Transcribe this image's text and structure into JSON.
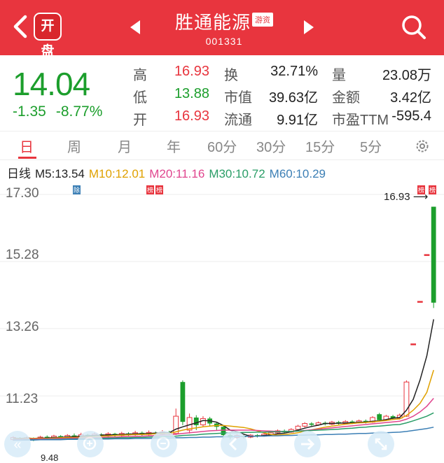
{
  "header": {
    "logo_text": "开盘",
    "stock_name": "胜通能源",
    "stock_tag": "游资",
    "stock_code": "001331",
    "icons": [
      "back-arrow-icon",
      "prev-arrow-icon",
      "next-arrow-icon",
      "search-icon"
    ]
  },
  "quote": {
    "price": "14.04",
    "change": "-1.35",
    "change_pct": "-8.77%",
    "rows": [
      [
        {
          "label": "高",
          "value": "16.93"
        },
        {
          "label": "换",
          "value": "32.71%"
        },
        {
          "label": "量",
          "value": "23.08万"
        }
      ],
      [
        {
          "label": "低",
          "value": "13.88"
        },
        {
          "label": "市值",
          "value": "39.63亿"
        },
        {
          "label": "金额",
          "value": "3.42亿"
        }
      ],
      [
        {
          "label": "开",
          "value": "16.93"
        },
        {
          "label": "流通",
          "value": "9.91亿"
        },
        {
          "label": "市盈TTM",
          "value": "-595.4"
        }
      ]
    ],
    "colors": {
      "up": "#e8353e",
      "down": "#1c9e2c"
    }
  },
  "tabs": [
    "日",
    "周",
    "月",
    "年",
    "60分",
    "30分",
    "15分",
    "5分"
  ],
  "active_tab": "日",
  "ma": {
    "label": "日线",
    "items": [
      {
        "text": "M5:13.54",
        "color": "#222222"
      },
      {
        "text": "M10:12.01",
        "color": "#e0a100"
      },
      {
        "text": "M20:11.16",
        "color": "#e0458e"
      },
      {
        "text": "M30:10.72",
        "color": "#2a9d67"
      },
      {
        "text": "M60:10.29",
        "color": "#3c7fb5"
      }
    ]
  },
  "chart_data": {
    "type": "candlestick",
    "y_ticks": [
      "17.30",
      "15.28",
      "13.26",
      "11.23"
    ],
    "last_high_label": "16.93",
    "low_label": "9.48",
    "markers": [
      {
        "text": "除",
        "color": "#3c7fb5"
      },
      {
        "text": "榜",
        "color": "#e8353e"
      },
      {
        "text": "榜",
        "color": "#e8353e"
      },
      {
        "text": "榜",
        "color": "#e8353e"
      },
      {
        "text": "榜",
        "color": "#e8353e"
      }
    ],
    "candles": [
      {
        "o": 9.92,
        "c": 9.98,
        "h": 10.02,
        "l": 9.88
      },
      {
        "o": 9.96,
        "c": 9.94,
        "h": 9.99,
        "l": 9.9
      },
      {
        "o": 9.93,
        "c": 9.97,
        "h": 10.01,
        "l": 9.89
      },
      {
        "o": 9.95,
        "c": 9.91,
        "h": 9.98,
        "l": 9.87
      },
      {
        "o": 9.92,
        "c": 9.99,
        "h": 10.03,
        "l": 9.9
      },
      {
        "o": 10.0,
        "c": 9.95,
        "h": 10.04,
        "l": 9.92
      },
      {
        "o": 9.96,
        "c": 10.02,
        "h": 10.06,
        "l": 9.94
      },
      {
        "o": 10.02,
        "c": 9.97,
        "h": 10.05,
        "l": 9.93
      },
      {
        "o": 9.98,
        "c": 10.04,
        "h": 10.08,
        "l": 9.95
      },
      {
        "o": 10.04,
        "c": 10.0,
        "h": 10.1,
        "l": 9.97
      },
      {
        "o": 10.01,
        "c": 10.06,
        "h": 10.12,
        "l": 9.98
      },
      {
        "o": 10.06,
        "c": 10.01,
        "h": 10.09,
        "l": 9.97
      },
      {
        "o": 10.02,
        "c": 10.08,
        "h": 10.13,
        "l": 10.0
      },
      {
        "o": 10.07,
        "c": 10.02,
        "h": 10.11,
        "l": 9.98
      },
      {
        "o": 10.03,
        "c": 10.09,
        "h": 10.14,
        "l": 10.0
      },
      {
        "o": 10.09,
        "c": 10.04,
        "h": 10.12,
        "l": 10.0
      },
      {
        "o": 10.04,
        "c": 10.1,
        "h": 10.15,
        "l": 10.01
      },
      {
        "o": 10.1,
        "c": 10.05,
        "h": 10.14,
        "l": 10.01
      },
      {
        "o": 10.06,
        "c": 10.12,
        "h": 10.18,
        "l": 10.03
      },
      {
        "o": 10.12,
        "c": 10.06,
        "h": 10.16,
        "l": 10.02
      },
      {
        "o": 10.07,
        "c": 10.13,
        "h": 10.19,
        "l": 10.04
      },
      {
        "o": 10.12,
        "c": 10.08,
        "h": 10.16,
        "l": 10.03
      },
      {
        "o": 10.08,
        "c": 10.14,
        "h": 10.2,
        "l": 10.05
      },
      {
        "o": 10.14,
        "c": 10.1,
        "h": 10.18,
        "l": 10.06
      },
      {
        "o": 10.1,
        "c": 10.62,
        "h": 10.85,
        "l": 10.05
      },
      {
        "o": 11.65,
        "c": 10.45,
        "h": 11.7,
        "l": 10.35
      },
      {
        "o": 10.2,
        "c": 10.58,
        "h": 10.7,
        "l": 10.1
      },
      {
        "o": 10.58,
        "c": 10.35,
        "h": 10.65,
        "l": 10.2
      },
      {
        "o": 10.36,
        "c": 10.55,
        "h": 10.62,
        "l": 10.3
      },
      {
        "o": 10.55,
        "c": 10.4,
        "h": 10.6,
        "l": 10.33
      },
      {
        "o": 10.4,
        "c": 10.3,
        "h": 10.45,
        "l": 10.2
      },
      {
        "o": 10.3,
        "c": 10.05,
        "h": 10.35,
        "l": 9.95
      },
      {
        "o": 10.05,
        "c": 9.98,
        "h": 10.1,
        "l": 9.92
      },
      {
        "o": 9.98,
        "c": 10.04,
        "h": 10.08,
        "l": 9.94
      },
      {
        "o": 10.02,
        "c": 9.99,
        "h": 10.06,
        "l": 9.95
      },
      {
        "o": 9.99,
        "c": 10.05,
        "h": 10.08,
        "l": 9.96
      },
      {
        "o": 10.05,
        "c": 10.02,
        "h": 10.08,
        "l": 9.98
      },
      {
        "o": 10.02,
        "c": 10.08,
        "h": 10.12,
        "l": 10.0
      },
      {
        "o": 10.07,
        "c": 10.12,
        "h": 10.16,
        "l": 10.04
      },
      {
        "o": 10.12,
        "c": 10.18,
        "h": 10.22,
        "l": 10.08
      },
      {
        "o": 10.18,
        "c": 10.14,
        "h": 10.22,
        "l": 10.1
      },
      {
        "o": 10.14,
        "c": 10.22,
        "h": 10.26,
        "l": 10.12
      },
      {
        "o": 10.22,
        "c": 10.32,
        "h": 10.36,
        "l": 10.18
      },
      {
        "o": 10.32,
        "c": 10.4,
        "h": 10.44,
        "l": 10.28
      },
      {
        "o": 10.4,
        "c": 10.36,
        "h": 10.44,
        "l": 10.32
      },
      {
        "o": 10.36,
        "c": 10.42,
        "h": 10.46,
        "l": 10.33
      },
      {
        "o": 10.42,
        "c": 10.38,
        "h": 10.46,
        "l": 10.34
      },
      {
        "o": 10.38,
        "c": 10.44,
        "h": 10.48,
        "l": 10.35
      },
      {
        "o": 10.44,
        "c": 10.4,
        "h": 10.48,
        "l": 10.36
      },
      {
        "o": 10.4,
        "c": 10.46,
        "h": 10.5,
        "l": 10.37
      },
      {
        "o": 10.46,
        "c": 10.42,
        "h": 10.5,
        "l": 10.38
      },
      {
        "o": 10.42,
        "c": 10.48,
        "h": 10.52,
        "l": 10.4
      },
      {
        "o": 10.48,
        "c": 10.44,
        "h": 10.52,
        "l": 10.4
      },
      {
        "o": 10.44,
        "c": 10.58,
        "h": 10.62,
        "l": 10.42
      },
      {
        "o": 10.68,
        "c": 10.5,
        "h": 10.72,
        "l": 10.46
      },
      {
        "o": 10.5,
        "c": 10.62,
        "h": 10.66,
        "l": 10.48
      },
      {
        "o": 10.62,
        "c": 10.56,
        "h": 10.66,
        "l": 10.52
      },
      {
        "o": 10.56,
        "c": 10.65,
        "h": 10.7,
        "l": 10.52
      },
      {
        "o": 10.62,
        "c": 11.65,
        "h": 11.7,
        "l": 10.6
      },
      {
        "o": 12.8,
        "c": 12.8,
        "h": 12.8,
        "l": 12.8
      },
      {
        "o": 14.08,
        "c": 14.08,
        "h": 14.08,
        "l": 14.08
      },
      {
        "o": 15.49,
        "c": 15.49,
        "h": 15.49,
        "l": 15.49
      },
      {
        "o": 16.93,
        "c": 14.04,
        "h": 16.93,
        "l": 13.88
      }
    ],
    "ma5": [
      9.95,
      9.95,
      9.96,
      9.95,
      9.96,
      9.96,
      9.98,
      9.98,
      10.0,
      10.0,
      10.02,
      10.03,
      10.04,
      10.05,
      10.06,
      10.06,
      10.07,
      10.08,
      10.09,
      10.09,
      10.1,
      10.11,
      10.12,
      10.12,
      10.23,
      10.3,
      10.36,
      10.42,
      10.49,
      10.48,
      10.44,
      10.34,
      10.2,
      10.15,
      10.08,
      10.01,
      10.02,
      10.04,
      10.06,
      10.09,
      10.11,
      10.15,
      10.2,
      10.26,
      10.31,
      10.35,
      10.4,
      10.4,
      10.41,
      10.42,
      10.42,
      10.44,
      10.44,
      10.47,
      10.48,
      10.52,
      10.56,
      10.58,
      10.8,
      11.13,
      11.71,
      12.44,
      13.54
    ],
    "ma10": [
      9.94,
      9.94,
      9.95,
      9.95,
      9.95,
      9.95,
      9.96,
      9.97,
      9.98,
      9.98,
      9.99,
      10.0,
      10.01,
      10.02,
      10.03,
      10.04,
      10.05,
      10.06,
      10.07,
      10.07,
      10.08,
      10.09,
      10.1,
      10.1,
      10.15,
      10.2,
      10.24,
      10.27,
      10.3,
      10.32,
      10.34,
      10.34,
      10.32,
      10.3,
      10.28,
      10.24,
      10.18,
      10.12,
      10.07,
      10.05,
      10.07,
      10.09,
      10.12,
      10.17,
      10.21,
      10.25,
      10.29,
      10.32,
      10.35,
      10.38,
      10.4,
      10.42,
      10.43,
      10.45,
      10.47,
      10.49,
      10.52,
      10.54,
      10.64,
      10.8,
      11.01,
      11.34,
      12.01
    ],
    "ma20": [
      9.92,
      9.92,
      9.93,
      9.93,
      9.93,
      9.94,
      9.94,
      9.95,
      9.95,
      9.96,
      9.96,
      9.97,
      9.97,
      9.98,
      9.99,
      9.99,
      10.0,
      10.01,
      10.01,
      10.02,
      10.03,
      10.04,
      10.05,
      10.06,
      10.08,
      10.1,
      10.12,
      10.14,
      10.16,
      10.18,
      10.19,
      10.2,
      10.2,
      10.2,
      10.2,
      10.2,
      10.19,
      10.18,
      10.17,
      10.16,
      10.16,
      10.16,
      10.17,
      10.19,
      10.21,
      10.23,
      10.25,
      10.27,
      10.29,
      10.31,
      10.33,
      10.35,
      10.37,
      10.39,
      10.41,
      10.43,
      10.45,
      10.47,
      10.53,
      10.62,
      10.75,
      10.92,
      11.16
    ],
    "ma30": [
      9.9,
      9.9,
      9.91,
      9.91,
      9.91,
      9.92,
      9.92,
      9.92,
      9.93,
      9.93,
      9.94,
      9.94,
      9.95,
      9.95,
      9.96,
      9.96,
      9.97,
      9.97,
      9.98,
      9.98,
      9.99,
      10.0,
      10.0,
      10.01,
      10.02,
      10.04,
      10.05,
      10.06,
      10.08,
      10.09,
      10.1,
      10.11,
      10.12,
      10.12,
      10.13,
      10.13,
      10.14,
      10.14,
      10.15,
      10.15,
      10.16,
      10.16,
      10.17,
      10.18,
      10.19,
      10.2,
      10.21,
      10.22,
      10.23,
      10.25,
      10.26,
      10.28,
      10.29,
      10.31,
      10.32,
      10.34,
      10.36,
      10.37,
      10.42,
      10.48,
      10.55,
      10.62,
      10.72
    ],
    "ma60": [
      9.9,
      9.9,
      9.9,
      9.9,
      9.91,
      9.91,
      9.91,
      9.91,
      9.92,
      9.92,
      9.92,
      9.92,
      9.93,
      9.93,
      9.93,
      9.94,
      9.94,
      9.94,
      9.95,
      9.95,
      9.95,
      9.96,
      9.96,
      9.96,
      9.97,
      9.97,
      9.98,
      9.98,
      9.99,
      9.99,
      10.0,
      10.0,
      10.0,
      10.01,
      10.01,
      10.02,
      10.02,
      10.02,
      10.03,
      10.03,
      10.04,
      10.04,
      10.05,
      10.05,
      10.06,
      10.06,
      10.07,
      10.07,
      10.08,
      10.08,
      10.09,
      10.1,
      10.1,
      10.11,
      10.12,
      10.12,
      10.13,
      10.14,
      10.16,
      10.19,
      10.22,
      10.25,
      10.29
    ]
  }
}
